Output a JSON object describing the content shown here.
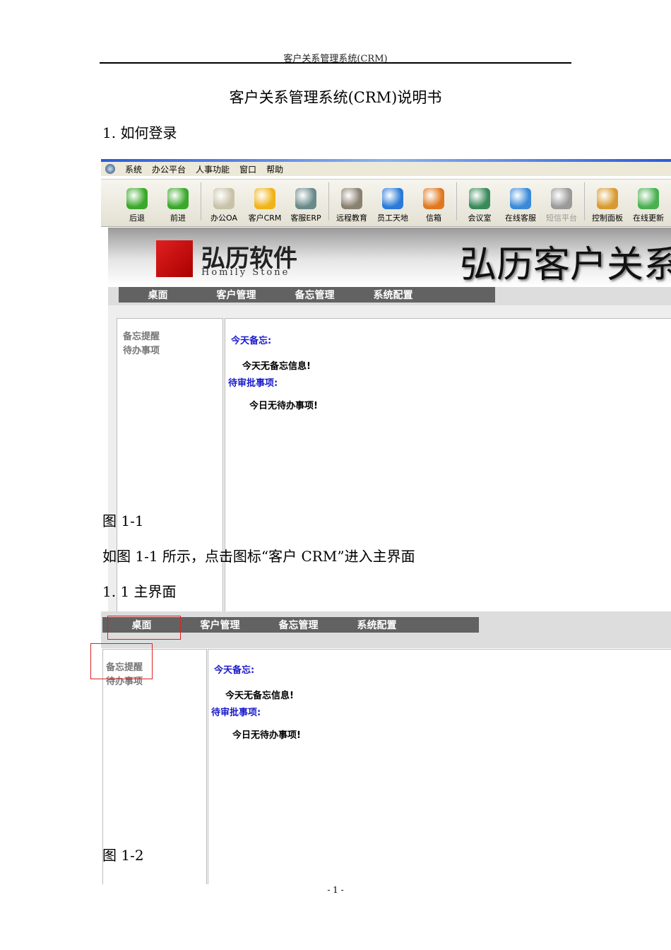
{
  "header": {
    "running_title": "客户关系管理系统(CRM)",
    "doc_title": "客户关系管理系统(CRM)说明书",
    "section": "1.  如何登录"
  },
  "screenshot1": {
    "menu": [
      "系统",
      "办公平台",
      "人事功能",
      "窗口",
      "帮助"
    ],
    "toolbar": [
      {
        "label": "后退",
        "icon": "back-arrow-icon",
        "color": "#3aa82a"
      },
      {
        "label": "前进",
        "icon": "forward-arrow-icon",
        "color": "#3aa82a"
      },
      {
        "label": "办公OA",
        "icon": "notepad-icon",
        "color": "#c8c2a8"
      },
      {
        "label": "客户CRM",
        "icon": "person-icon",
        "color": "#f0b418"
      },
      {
        "label": "客服ERP",
        "icon": "monitor-icon",
        "color": "#6a8a8a"
      },
      {
        "label": "远程教育",
        "icon": "pens-icon",
        "color": "#8a8070"
      },
      {
        "label": "员工天地",
        "icon": "globe-icon",
        "color": "#2a7ad8"
      },
      {
        "label": "信箱",
        "icon": "mailbox-icon",
        "color": "#e07820"
      },
      {
        "label": "会议室",
        "icon": "people-icon",
        "color": "#3a8a5a"
      },
      {
        "label": "在线客服",
        "icon": "chat-icon",
        "color": "#3a8ad8"
      },
      {
        "label": "短信平台",
        "icon": "message-icon",
        "color": "#9a9a9a",
        "disabled": true
      },
      {
        "label": "控制面板",
        "icon": "tools-icon",
        "color": "#d89a30"
      },
      {
        "label": "在线更新",
        "icon": "update-icon",
        "color": "#4ab050"
      }
    ],
    "logo_text": "弘历软件",
    "logo_sub": "Homily   Stone",
    "banner_title": "弘历客户关系",
    "nav": [
      "桌面",
      "客户管理",
      "备忘管理",
      "系统配置"
    ],
    "side": [
      "备忘提醒",
      "待办事项"
    ],
    "memo_label": "今天备忘:",
    "memo_empty": "今天无备忘信息!",
    "approval_label": "待审批事项:",
    "approval_empty": "今日无待办事项!"
  },
  "captions": {
    "fig1": "图 1-1",
    "desc": "如图 1-1 所示，点击图标“客户 CRM”进入主界面",
    "sub": "1.  1  主界面",
    "fig2": "图 1-2"
  },
  "footer": "- 1 -"
}
